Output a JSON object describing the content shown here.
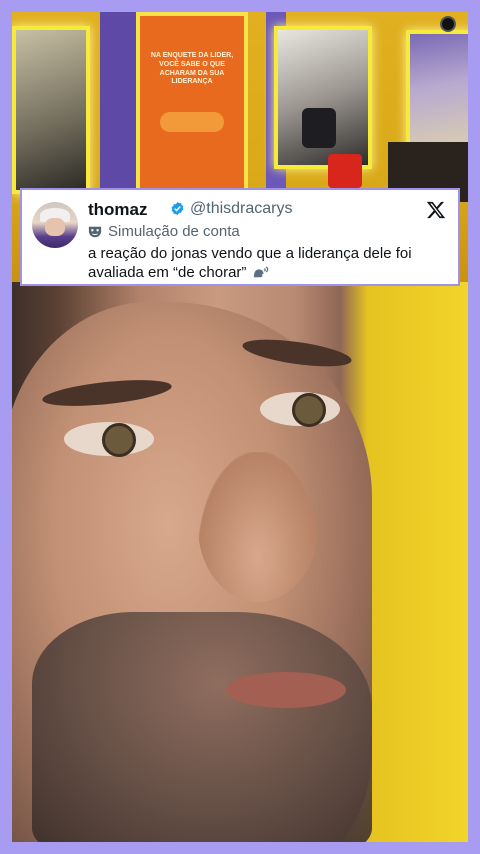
{
  "background": {
    "border_color": "#a89cf2"
  },
  "poster": {
    "text": "NA ENQUETE DA LIDER, VOCÊ SABE O QUE ACHARAM DA SUA LIDERANÇA"
  },
  "tweet": {
    "display_name": "thomaz",
    "handle": "@thisdracarys",
    "badge_label": "Simulação de conta",
    "text": "a reação do jonas vendo que a liderança dele foi avaliada em “de chorar”",
    "icons": [
      "verified-badge-icon",
      "x-logo-icon",
      "simulation-mask-icon",
      "speaking-head-icon"
    ],
    "verified_color": "#1d9bf0"
  }
}
